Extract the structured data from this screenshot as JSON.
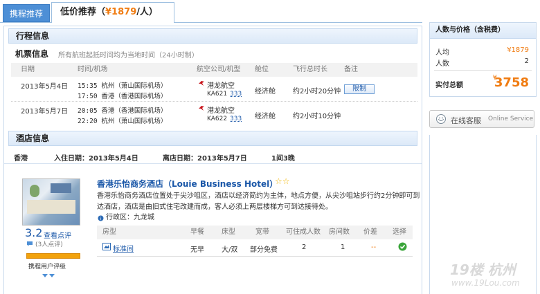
{
  "tabs": {
    "tab1": "携程推荐",
    "tab2_prefix": "低价推荐（",
    "tab2_price": "¥1879",
    "tab2_suffix": "/人）"
  },
  "itinerary": {
    "section_title": "行程信息",
    "ticket_label": "机票信息",
    "ticket_note": "所有航班起抵时间均为当地时间（24小时制）",
    "headers": [
      "日期",
      "时间/机场",
      "航空公司/机型",
      "舱位",
      "飞行总时长",
      "备注"
    ],
    "flights": [
      {
        "date": "2013年5月4日",
        "dep": "15:35 杭州（萧山国际机场）",
        "arr": "17:50 香港（香港国际机场）",
        "airline": "港龙航空",
        "flight_no": "KA621",
        "aircraft": "333",
        "cabin": "经济舱",
        "duration": "约2小时20分钟",
        "remark": "限制"
      },
      {
        "date": "2013年5月7日",
        "dep": "20:05 香港（香港国际机场）",
        "arr": "22:20 杭州（萧山国际机场）",
        "airline": "港龙航空",
        "flight_no": "KA622",
        "aircraft": "333",
        "cabin": "经济舱",
        "duration": "约2小时10分钟",
        "remark": ""
      }
    ]
  },
  "hotel_info": {
    "section_title": "酒店信息",
    "city": "香港",
    "checkin": "入住日期：2013年5月4日",
    "checkout": "离店日期：2013年5月7日",
    "nights": "1间3晚",
    "name": "香港乐怡商务酒店（Louie Business Hotel）",
    "stars": "☆☆",
    "desc_line1": "香港乐怡商务酒店位置处于尖沙咀区，酒店以经济简约为主体，地点方便，从尖沙咀站步行约2分钟即可到",
    "desc_line2": "达酒店，酒店是由旧式住宅改建而成，客人必须上两层楼梯方可到达接待处。",
    "district": "行政区：九龙城",
    "score": "3.2",
    "view_reviews": "查看点评",
    "review_count": "(3人点评)",
    "user_rating_label": "携程用户评级",
    "room_headers": [
      "房型",
      "早餐",
      "床型",
      "宽带",
      "可住成人数",
      "房间数",
      "价差",
      "选择"
    ],
    "room": {
      "type": "标准间",
      "breakfast": "无早",
      "bed": "大/双",
      "broadband": "部分免费",
      "adults": "2",
      "rooms": "1",
      "price_diff": "--"
    }
  },
  "price_panel": {
    "title": "人数与价格（含税费）",
    "per_person_label": "人均",
    "per_person_value": "¥1879",
    "people_label": "人数",
    "people_value": "2",
    "total_label": "实付总额",
    "total_currency": "¥",
    "total_value": "3758"
  },
  "service": {
    "label": "在线客服",
    "sub": "Online Service"
  },
  "watermark": {
    "brand": "19楼 杭州",
    "url": "www.19Lou.com"
  },
  "colors": {
    "accent": "#f07c12",
    "link": "#1a57a8",
    "tab_active_bg": "#4d8fd6"
  }
}
